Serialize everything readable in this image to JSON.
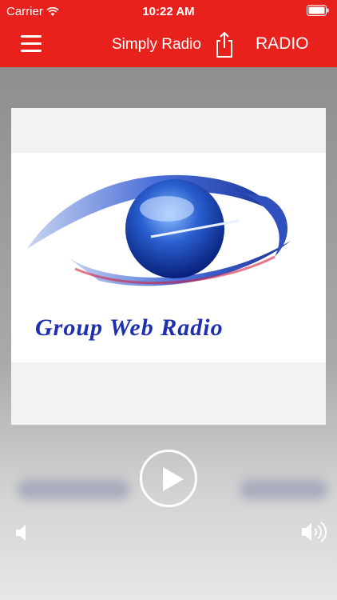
{
  "status_bar": {
    "carrier": "Carrier",
    "time": "10:22 AM"
  },
  "nav": {
    "title": "Simply Radio",
    "right_label": "RADIO"
  },
  "artwork": {
    "logo_text": "Group Web Radio"
  },
  "colors": {
    "accent": "#e8211d",
    "logo_blue": "#1f2fb0"
  },
  "icons": [
    "menu-icon",
    "share-icon",
    "play-icon",
    "volume-low-icon",
    "volume-high-icon",
    "wifi-icon",
    "battery-icon"
  ]
}
